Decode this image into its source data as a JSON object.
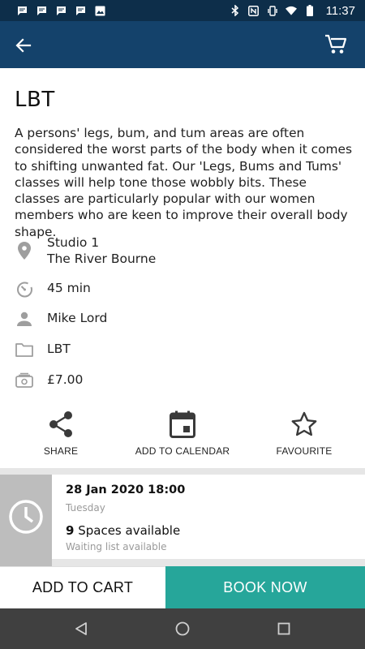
{
  "status_bar": {
    "time": "11:37",
    "left_icons": [
      "message-icon",
      "message-icon",
      "message-icon",
      "message-icon",
      "image-icon"
    ],
    "right_icons": [
      "bluetooth-icon",
      "nfc-icon",
      "vibrate-icon",
      "wifi-icon",
      "battery-icon"
    ]
  },
  "app_bar": {
    "back_icon": "arrow-back-icon",
    "cart_icon": "cart-icon"
  },
  "class": {
    "title": "LBT",
    "description": "A persons' legs, bum, and tum areas are often considered the worst parts of the body when it comes to shifting unwanted fat. Our 'Legs, Bums and Tums' classes will  help tone those wobbly bits. These classes are particularly popular with our women members who are keen to improve their overall body shape.",
    "location_line1": "Studio 1",
    "location_line2": "The River Bourne",
    "duration": "45 min",
    "instructor": "Mike Lord",
    "category": "LBT",
    "price": "£7.00"
  },
  "actions": {
    "share": "SHARE",
    "calendar": "ADD TO CALENDAR",
    "favourite": "FAVOURITE"
  },
  "session": {
    "datetime": "28 Jan 2020 18:00",
    "day": "Tuesday",
    "spaces_count": "9",
    "spaces_label": " Spaces available",
    "waiting": "Waiting list available"
  },
  "buttons": {
    "add_to_cart": "ADD TO CART",
    "book_now": "BOOK NOW"
  },
  "colors": {
    "status_bar": "#0d2e4a",
    "app_bar": "#14426b",
    "book_button": "#26a69a",
    "nav_bar": "#404040"
  }
}
